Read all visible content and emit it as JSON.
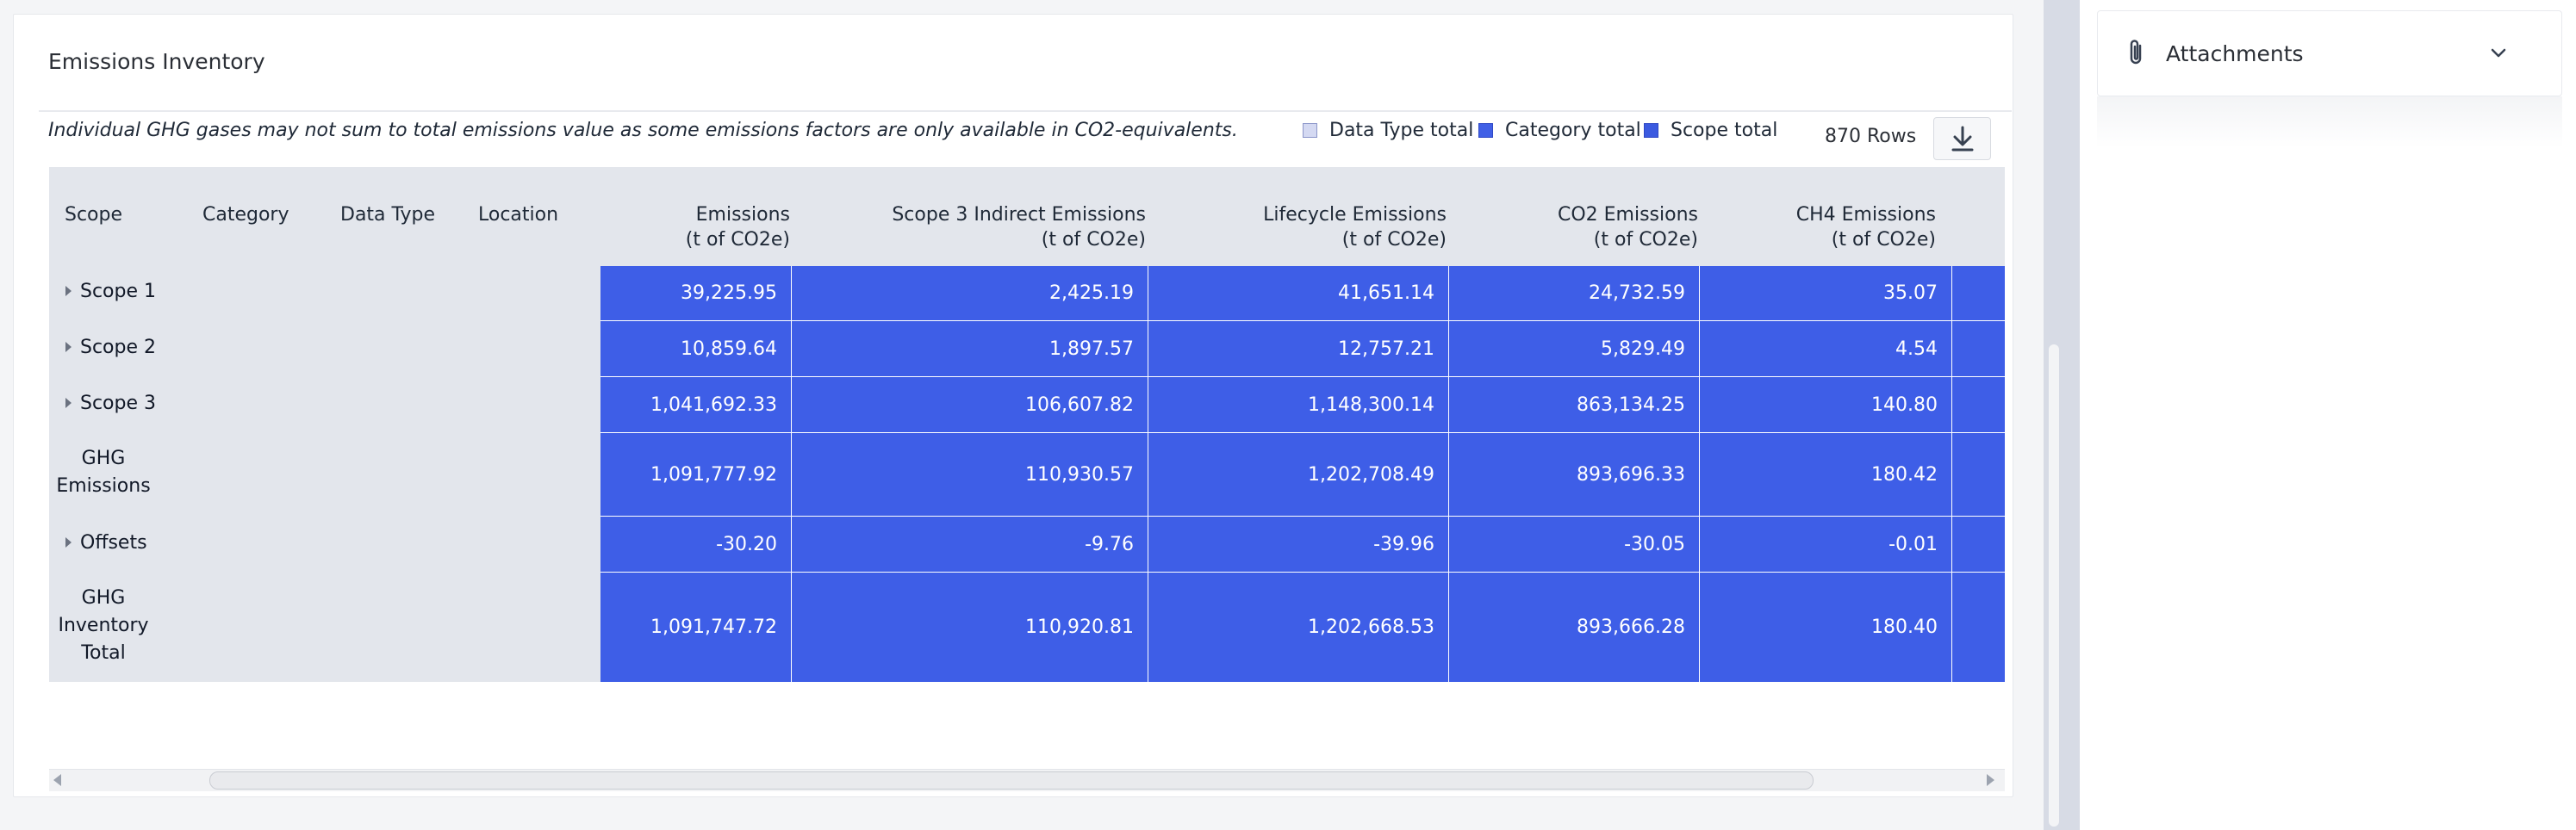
{
  "panel": {
    "title": "Emissions Inventory",
    "note": "Individual GHG gases may not sum to total emissions value as some emissions factors are only available in CO2-equivalents.",
    "legend": {
      "data_type_total": "Data Type total",
      "category_total": "Category total",
      "scope_total": "Scope total"
    },
    "row_count": "870 Rows",
    "download_icon": "download-icon"
  },
  "table": {
    "headers": {
      "scope": "Scope",
      "category": "Category",
      "data_type": "Data Type",
      "location": "Location",
      "emissions": {
        "line1": "Emissions",
        "line2": "(t of CO2e)"
      },
      "scope3_indirect": {
        "line1": "Scope 3 Indirect Emissions",
        "line2": "(t of CO2e)"
      },
      "lifecycle": {
        "line1": "Lifecycle Emissions",
        "line2": "(t of CO2e)"
      },
      "co2": {
        "line1": "CO2 Emissions",
        "line2": "(t of CO2e)"
      },
      "ch4": {
        "line1": "CH4 Emissions",
        "line2": "(t of CO2e)"
      }
    },
    "rows": [
      {
        "label": "Scope 1",
        "values": [
          "39,225.95",
          "2,425.19",
          "41,651.14",
          "24,732.59",
          "35.07"
        ]
      },
      {
        "label": "Scope 2",
        "values": [
          "10,859.64",
          "1,897.57",
          "12,757.21",
          "5,829.49",
          "4.54"
        ]
      },
      {
        "label": "Scope 3",
        "values": [
          "1,041,692.33",
          "106,607.82",
          "1,148,300.14",
          "863,134.25",
          "140.80"
        ]
      },
      {
        "label_lines": [
          "GHG",
          "Emissions"
        ],
        "values": [
          "1,091,777.92",
          "110,930.57",
          "1,202,708.49",
          "893,696.33",
          "180.42"
        ]
      },
      {
        "label": "Offsets",
        "values": [
          "-30.20",
          "-9.76",
          "-39.96",
          "-30.05",
          "-0.01"
        ]
      },
      {
        "label_lines": [
          "GHG",
          "Inventory",
          "Total"
        ],
        "values": [
          "1,091,747.72",
          "110,920.81",
          "1,202,668.53",
          "893,666.28",
          "180.40"
        ]
      }
    ]
  },
  "attachments": {
    "title": "Attachments",
    "icon": "paperclip-icon",
    "toggle_icon": "chevron-down-icon"
  },
  "colors": {
    "accent": "#3e5ee7",
    "header_bg": "#e3e6ec",
    "legend_data_type": "#d4d9f2"
  }
}
